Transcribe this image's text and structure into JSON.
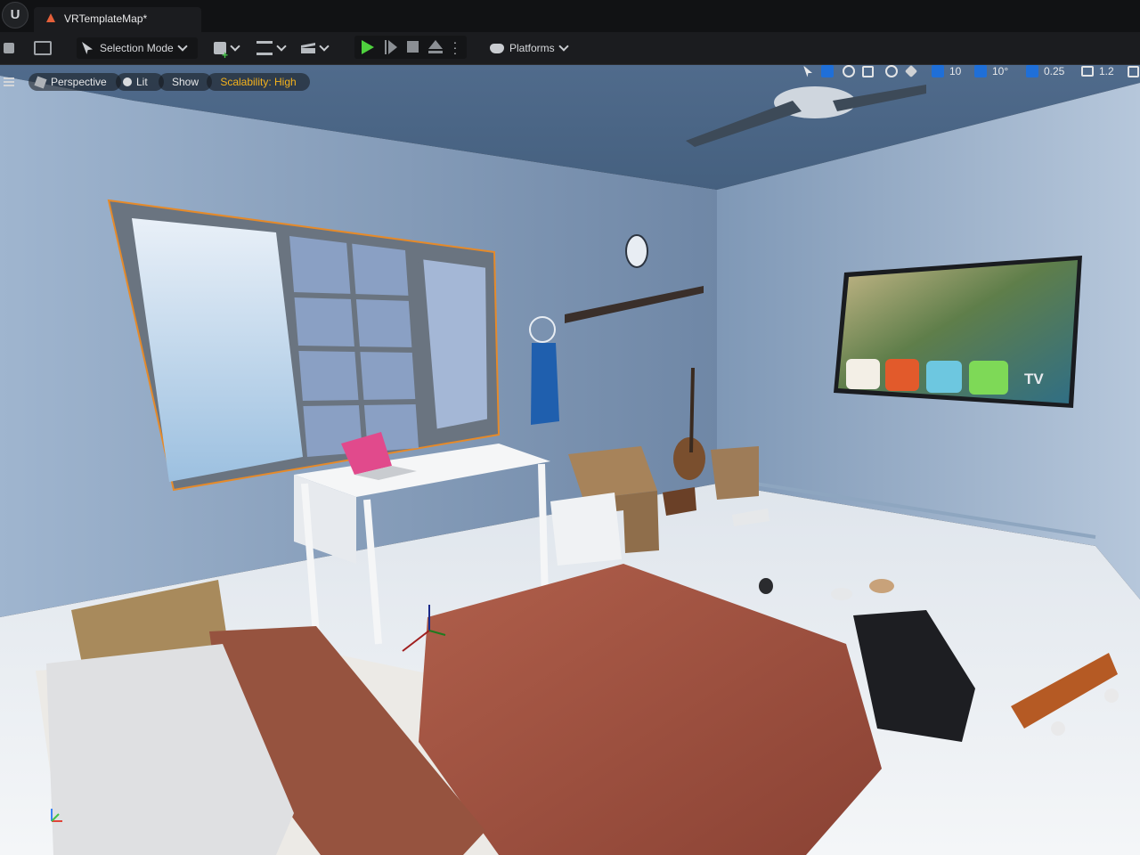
{
  "window": {
    "map_tab": "VRTemplateMap*"
  },
  "toolbar": {
    "selection_mode": "Selection Mode",
    "platforms": "Platforms"
  },
  "viewport": {
    "perspective": "Perspective",
    "lit": "Lit",
    "show": "Show",
    "scalability": "Scalability: High",
    "grid_snap": "10",
    "rotation_snap": "10°",
    "scale_snap": "0.25",
    "camera_speed": "1.2"
  },
  "scene": {
    "tv_label": "TV"
  },
  "colors": {
    "play_green": "#4fd13e",
    "accent_blue": "#1f6fd8",
    "scalability_yellow": "#f5b21c",
    "selection_orange": "#e58a2a"
  }
}
